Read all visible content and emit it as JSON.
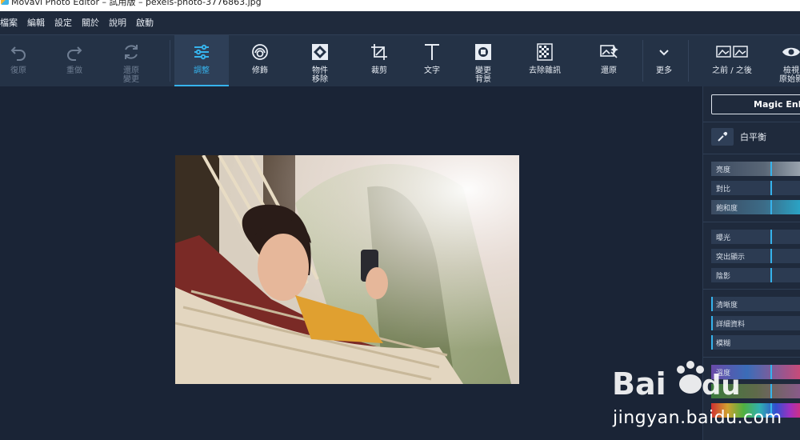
{
  "window": {
    "title": "Movavi Photo Editor – 試用版 – pexels-photo-3776863.jpg"
  },
  "menu": [
    "檔案",
    "編輯",
    "設定",
    "關於",
    "說明",
    "啟動"
  ],
  "toolbar": {
    "undo": "復原",
    "redo": "重做",
    "reset": "還原\n變更",
    "adjust": "調整",
    "retouch": "修飾",
    "object_removal": "物件\n移除",
    "crop": "裁剪",
    "text": "文字",
    "change_bg": "變更\n背景",
    "denoise": "去除雜訊",
    "restore": "還原",
    "more": "更多",
    "before_after": "之前 / 之後",
    "view_original": "檢視\n原始影"
  },
  "panel": {
    "magic": "Magic Enha",
    "white_balance": "白平衡",
    "sliders": {
      "brightness": "亮度",
      "contrast": "對比",
      "saturation": "飽和度",
      "exposure": "曝光",
      "highlights": "突出顯示",
      "shadows": "陰影",
      "clarity": "清晰度",
      "detail": "詳細資料",
      "blur": "模糊",
      "temperature": "溫度"
    }
  },
  "watermark": {
    "url": "jingyan.baidu.com"
  },
  "colors": {
    "accent": "#36b3ec",
    "toolbar": "#243246",
    "canvas": "#1a2436"
  }
}
